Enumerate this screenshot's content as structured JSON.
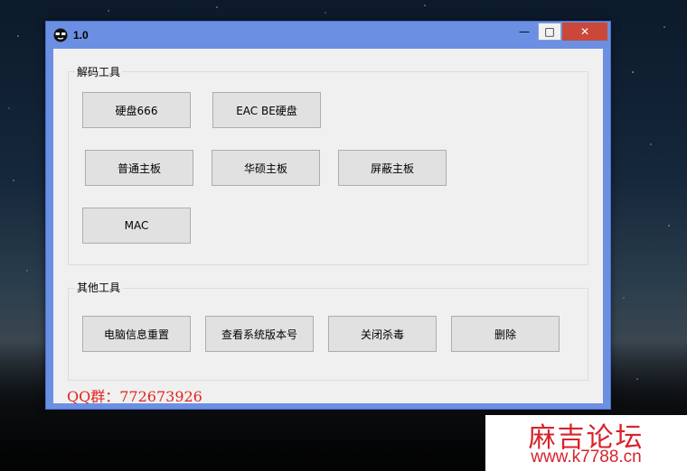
{
  "window": {
    "title": "1.0",
    "minimize_label": "—",
    "maximize_label": "□",
    "close_label": "✕"
  },
  "groups": {
    "decode": {
      "label": "解码工具",
      "buttons": [
        "硬盘666",
        "EAC BE硬盘",
        "普通主板",
        "华硕主板",
        "屏蔽主板",
        "MAC"
      ]
    },
    "other": {
      "label": "其他工具",
      "buttons": [
        "电脑信息重置",
        "查看系统版本号",
        "关闭杀毒",
        "删除"
      ]
    }
  },
  "qq_text": "QQ群：772673926",
  "watermark": {
    "title": "麻吉论坛",
    "url": "www.k7788.cn"
  },
  "colors": {
    "window_frame": "#6b8fe2",
    "close_button": "#c9483a",
    "qq_text": "#e5231c",
    "watermark_text": "#d8232a"
  }
}
